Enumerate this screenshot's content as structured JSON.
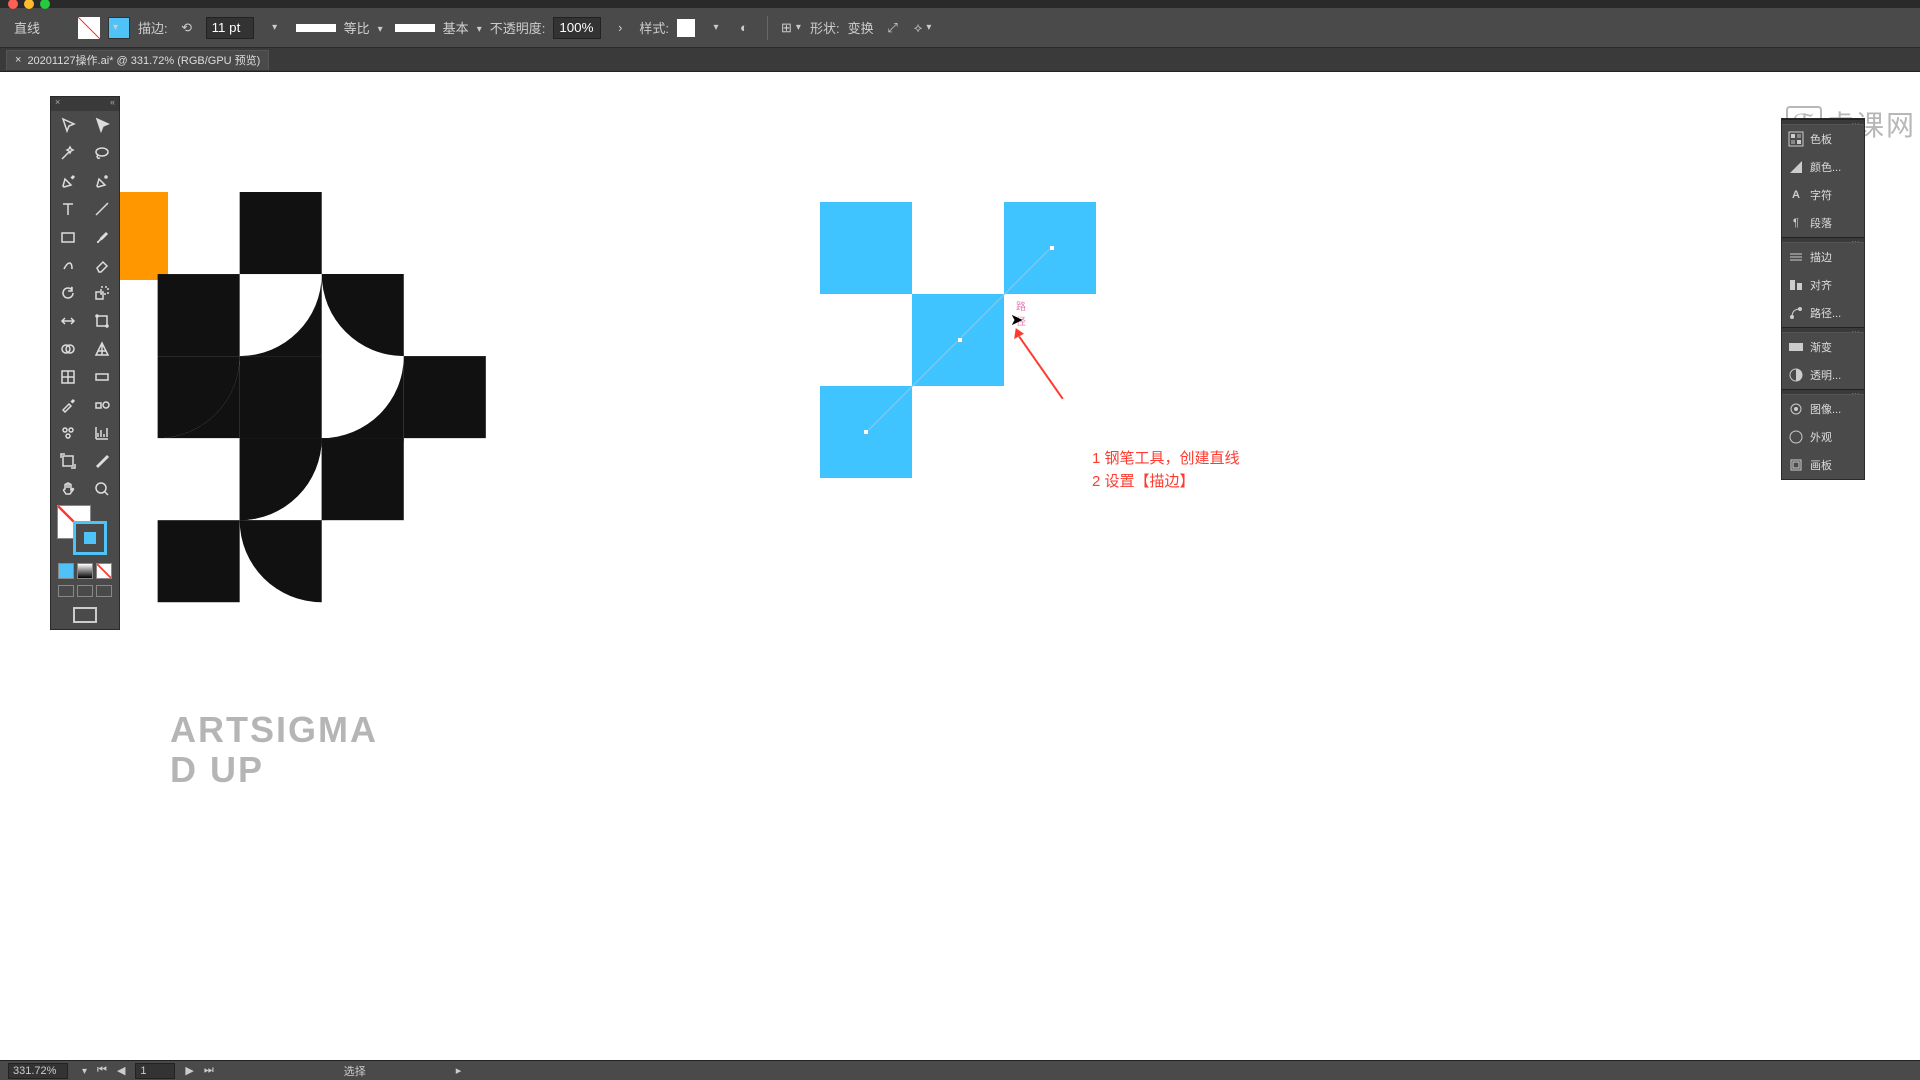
{
  "options": {
    "tool": "直线",
    "stroke_label": "描边:",
    "stroke_weight": "11 pt",
    "profile": "等比",
    "brush": "基本",
    "opacity_label": "不透明度:",
    "opacity_value": "100%",
    "style_label": "样式:",
    "shape_label": "形状:",
    "transform_label": "变换"
  },
  "tab": {
    "label": "20201127操作.ai* @ 331.72% (RGB/GPU 预览)"
  },
  "right_panels": {
    "items_a": [
      {
        "icon": "swatches-icon",
        "label": "色板"
      },
      {
        "icon": "color-icon",
        "label": "颜色..."
      },
      {
        "icon": "char-icon",
        "label": "字符"
      },
      {
        "icon": "para-icon",
        "label": "段落"
      }
    ],
    "items_b": [
      {
        "icon": "stroke-icon",
        "label": "描边"
      },
      {
        "icon": "align-icon",
        "label": "对齐"
      },
      {
        "icon": "path-icon",
        "label": "路径..."
      }
    ],
    "items_c": [
      {
        "icon": "gradient-icon",
        "label": "渐变"
      },
      {
        "icon": "transp-icon",
        "label": "透明..."
      }
    ],
    "items_d": [
      {
        "icon": "image-icon",
        "label": "图像..."
      },
      {
        "icon": "appear-icon",
        "label": "外观"
      },
      {
        "icon": "artboard-icon",
        "label": "画板"
      }
    ]
  },
  "canvas": {
    "blue_label": "路径",
    "hint_1": "1 钢笔工具，创建直线",
    "hint_2": "2 设置【描边】",
    "artsigma_1": "ARTSIGMA",
    "artsigma_2": "D UP"
  },
  "status": {
    "zoom": "331.72%",
    "artboard": "1",
    "tool_hint": "选择"
  },
  "watermark": "虎课网"
}
